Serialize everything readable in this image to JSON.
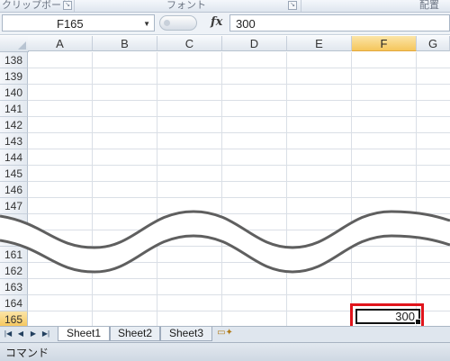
{
  "ribbon": {
    "groups": [
      {
        "label": "クリップボード"
      },
      {
        "label": "フォント"
      },
      {
        "label": "配置"
      }
    ]
  },
  "formula_bar": {
    "name_box": "F165",
    "fx_label": "fx",
    "value": "300"
  },
  "grid": {
    "columns": [
      "A",
      "B",
      "C",
      "D",
      "E",
      "F",
      "G"
    ],
    "active_column": "F",
    "rows_top": [
      "138",
      "139",
      "140",
      "141",
      "142",
      "143",
      "144",
      "145",
      "146",
      "147"
    ],
    "rows_bottom": [
      "161",
      "162",
      "163",
      "164",
      "165"
    ],
    "active_row": "165",
    "active_cell_value": "300"
  },
  "sheets": {
    "tabs": [
      "Sheet1",
      "Sheet2",
      "Sheet3"
    ],
    "active": "Sheet1"
  },
  "status": {
    "mode": "コマンド"
  },
  "colors": {
    "highlight": "#e0141b",
    "active_header": "#f5c65c",
    "wave_stroke": "#5f5f5f"
  }
}
